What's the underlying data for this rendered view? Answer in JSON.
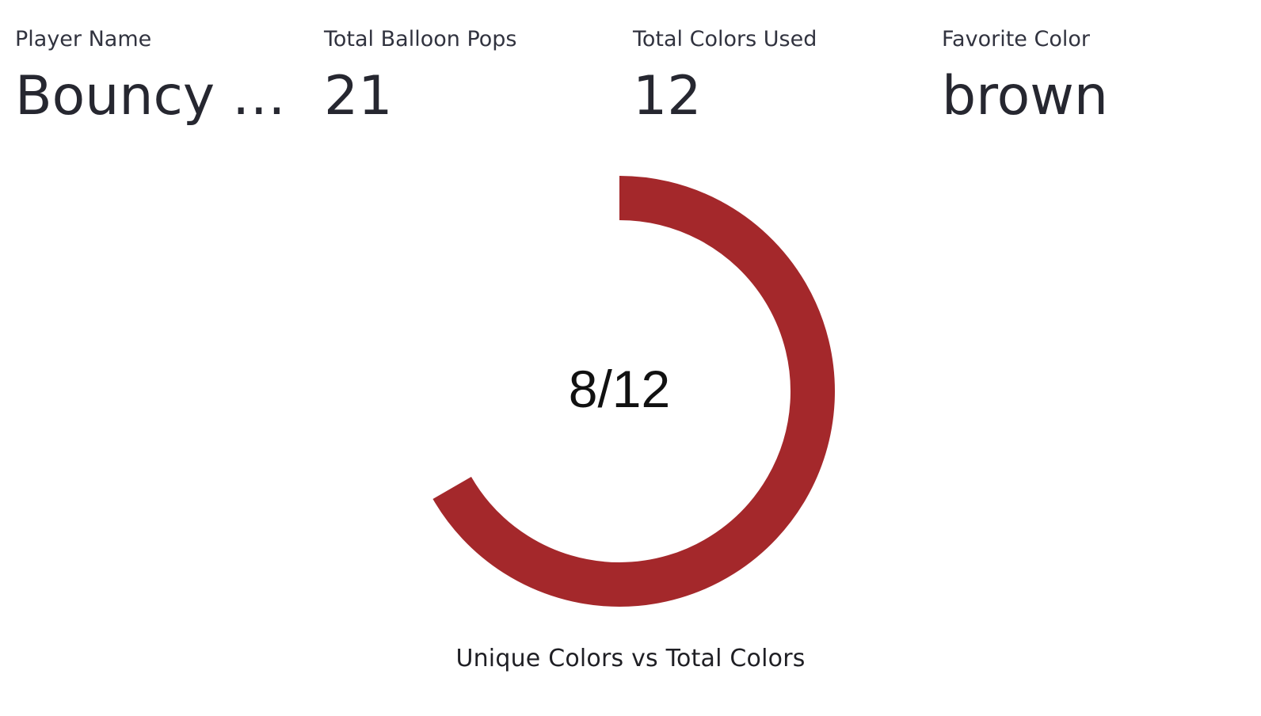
{
  "metrics": [
    {
      "label": "Player Name",
      "value": "Bouncy …"
    },
    {
      "label": "Total Balloon Pops",
      "value": "21"
    },
    {
      "label": "Total Colors Used",
      "value": "12"
    },
    {
      "label": "Favorite Color",
      "value": "brown"
    }
  ],
  "chart_data": {
    "type": "gauge",
    "value": 8,
    "max": 12,
    "center_label": "8/12",
    "caption": "Unique Colors vs Total Colors",
    "color": "#a4282b"
  }
}
